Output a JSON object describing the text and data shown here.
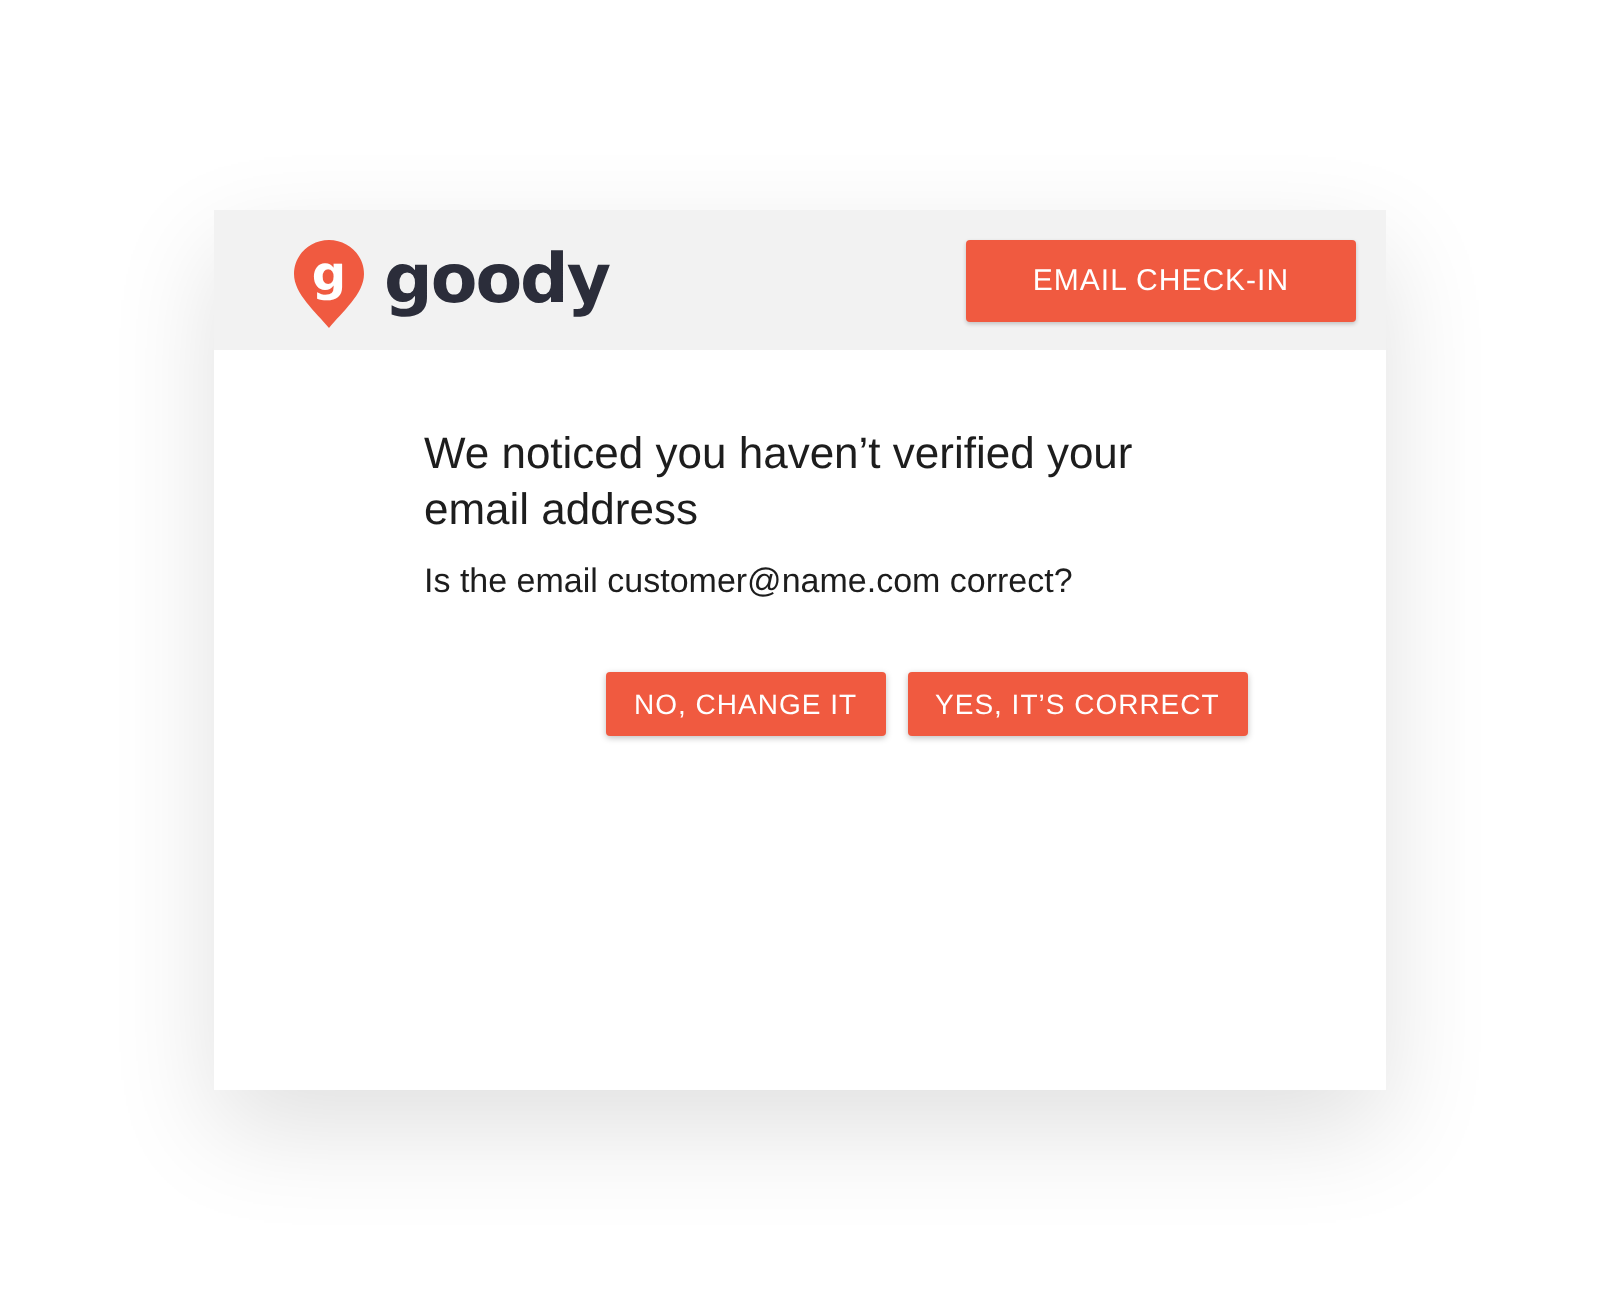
{
  "header": {
    "logo": {
      "mark": "g",
      "name": "goody"
    },
    "button": "EMAIL CHECK-IN"
  },
  "dialog": {
    "title": "We noticed you haven’t verified your email address",
    "question": "Is the email customer@name.com correct?",
    "buttons": [
      "NO, CHANGE IT",
      "YES, IT’S CORRECT"
    ]
  }
}
